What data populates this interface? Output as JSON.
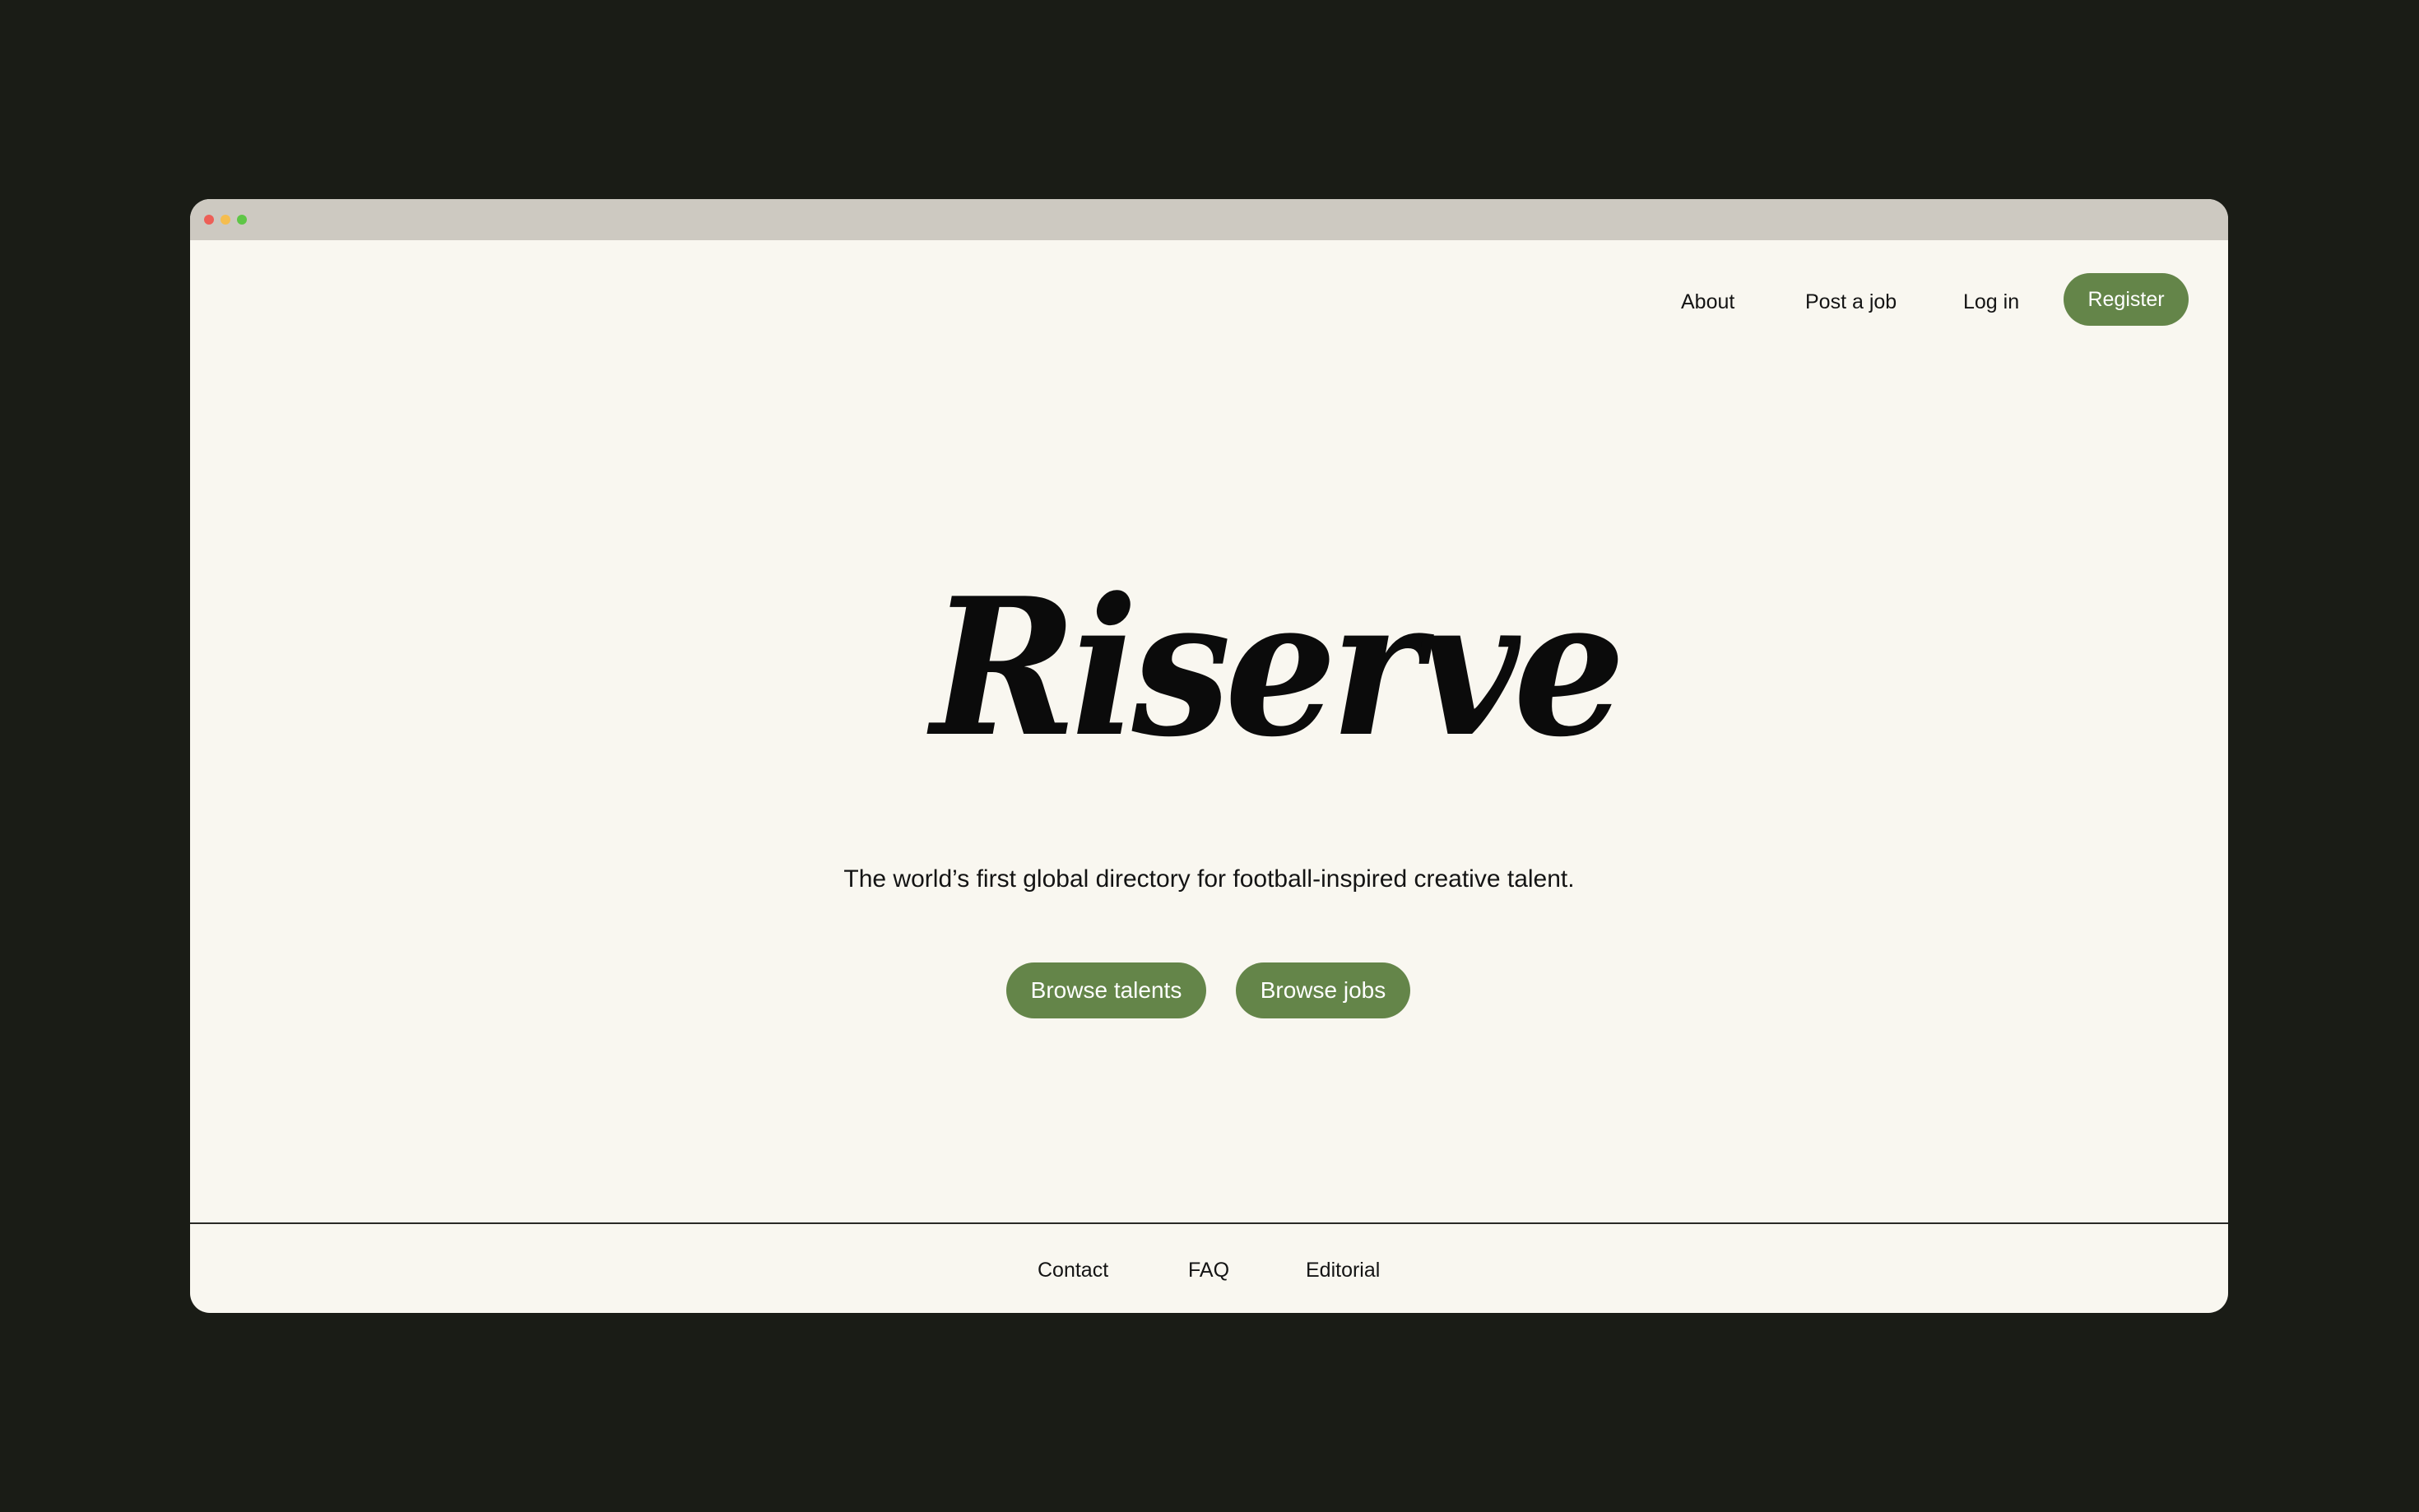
{
  "colors": {
    "page_background": "#1a1c16",
    "window_background": "#f9f7f0",
    "title_bar": "#cdc9c1",
    "accent_green": "#648549",
    "traffic_close": "#ed5f57",
    "traffic_minimize": "#f5bd4f",
    "traffic_maximize": "#5ec646"
  },
  "nav": {
    "about": "About",
    "post_job": "Post a job",
    "login": "Log in",
    "register": "Register"
  },
  "hero": {
    "logo_text": "Riserve",
    "tagline": "The world’s first global directory for football-inspired creative talent.",
    "browse_talents": "Browse talents",
    "browse_jobs": "Browse jobs"
  },
  "footer": {
    "contact": "Contact",
    "faq": "FAQ",
    "editorial": "Editorial"
  }
}
